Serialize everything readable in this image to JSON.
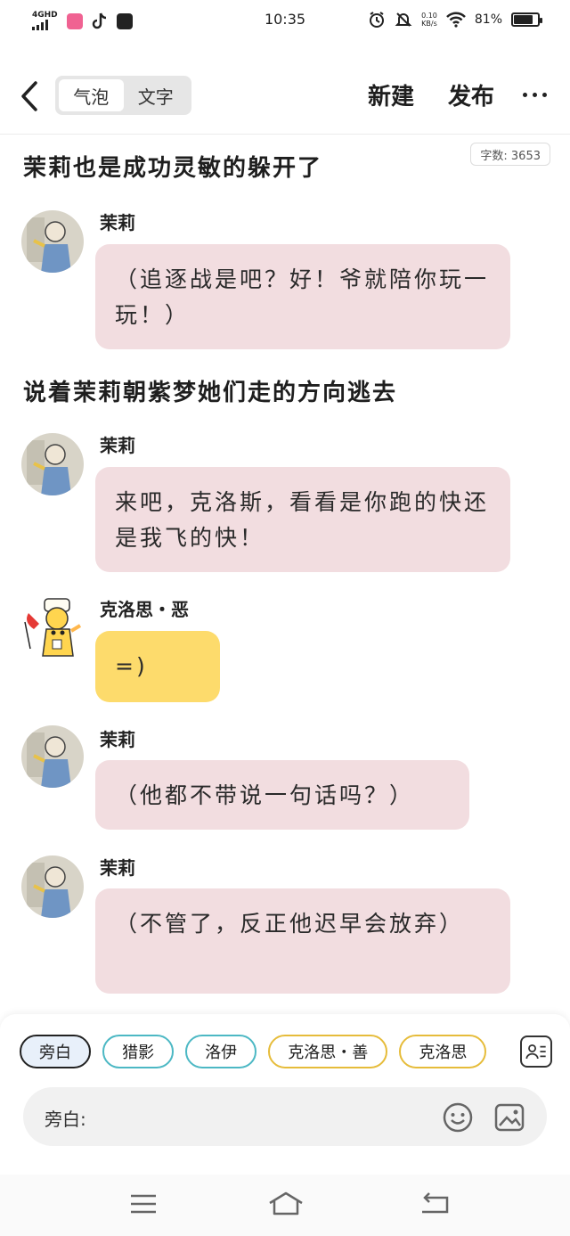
{
  "status": {
    "network": "4GHD",
    "time": "10:35",
    "speed_top": "0.10",
    "speed_bottom": "KB/s",
    "battery": "81%",
    "battery_level": 0.81
  },
  "header": {
    "tab_bubble": "气泡",
    "tab_text": "文字",
    "new_label": "新建",
    "publish_label": "发布"
  },
  "word_count": "字数: 3653",
  "narration": {
    "line1": "茉莉也是成功灵敏的躲开了",
    "line2": "说着茉莉朝紫梦她们走的方向逃去"
  },
  "messages": [
    {
      "name": "茉莉",
      "text": "（追逐战是吧？好！爷就陪你玩一玩！）"
    },
    {
      "name": "茉莉",
      "text": "来吧，克洛斯，看看是你跑的快还是我飞的快！"
    },
    {
      "name": "克洛思・恶",
      "text": "=)"
    },
    {
      "name": "茉莉",
      "text": "（他都不带说一句话吗？）"
    },
    {
      "name": "茉莉",
      "text": "（不管了，反正他迟早会放弃）"
    }
  ],
  "roles": [
    "旁白",
    "猎影",
    "洛伊",
    "克洛思・善",
    "克洛思"
  ],
  "input": {
    "label": "旁白:"
  },
  "colors": {
    "bubble_pink": "#f2dde0",
    "bubble_yellow": "#fddb6c",
    "chip_cyan": "#4cb8c4",
    "chip_gold": "#e6bc3a"
  }
}
